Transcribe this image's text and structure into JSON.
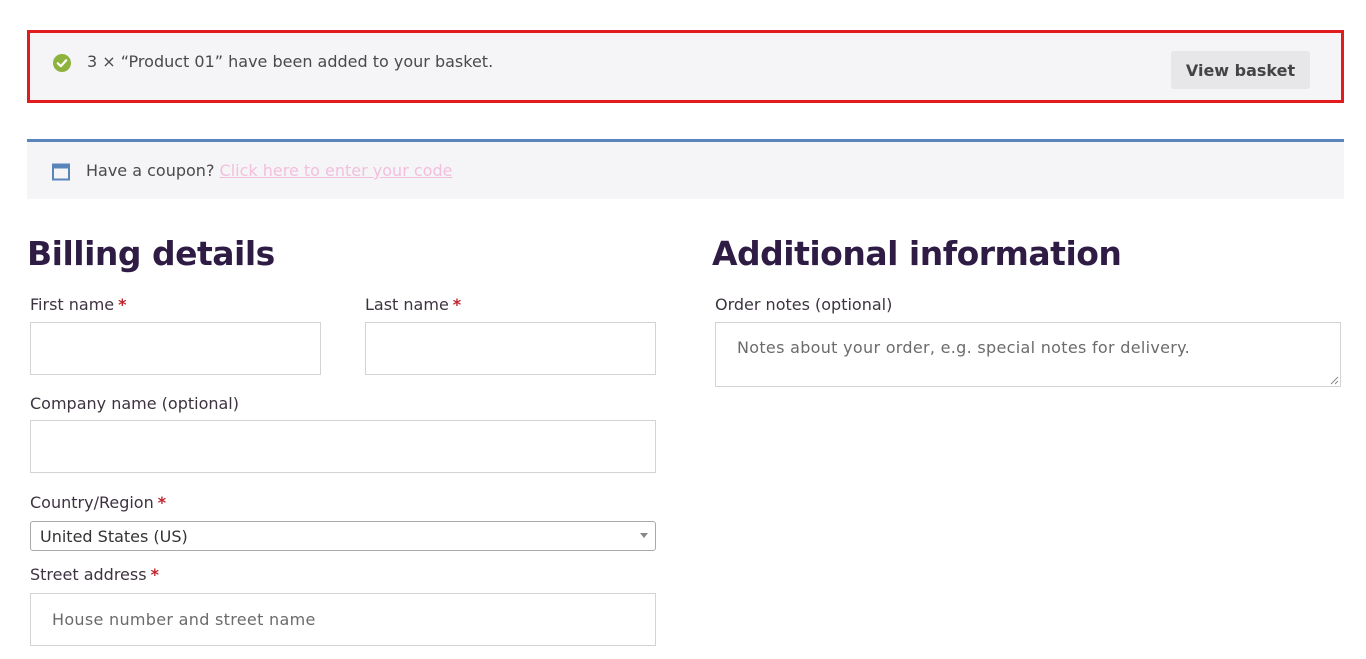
{
  "notice": {
    "message": "3 × “Product 01” have been added to your basket.",
    "button_label": "View basket",
    "icon": "check-circle-icon",
    "border_color": "#e21c1c",
    "icon_color": "#8db33d"
  },
  "coupon": {
    "text": "Have a coupon?",
    "link_text": "Click here to enter your code",
    "icon": "calendar-icon",
    "border_color": "#5a85ba"
  },
  "billing": {
    "title": "Billing details",
    "first_name": {
      "label": "First name",
      "required_mark": "*",
      "value": ""
    },
    "last_name": {
      "label": "Last name",
      "required_mark": "*",
      "value": ""
    },
    "company": {
      "label": "Company name (optional)",
      "value": ""
    },
    "country": {
      "label": "Country/Region",
      "required_mark": "*",
      "selected": "United States (US)"
    },
    "street": {
      "label": "Street address",
      "required_mark": "*",
      "placeholder": "House number and street name"
    }
  },
  "additional": {
    "title": "Additional information",
    "order_notes": {
      "label": "Order notes (optional)",
      "placeholder": "Notes about your order, e.g. special notes for delivery."
    }
  }
}
